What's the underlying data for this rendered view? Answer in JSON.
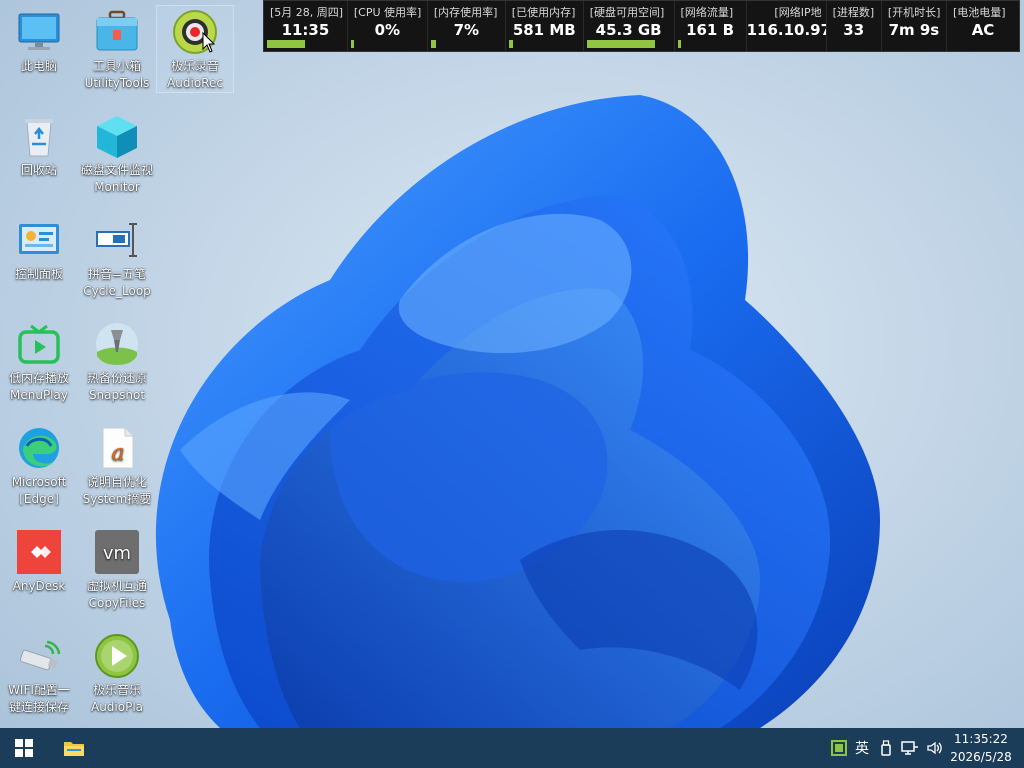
{
  "desktop": {
    "icons": [
      {
        "label": "此电脑",
        "icon": "this-pc-icon"
      },
      {
        "label": "工具小箱",
        "label2": "UtilityTools",
        "icon": "toolbox-icon"
      },
      {
        "label": "极乐录音",
        "label2": "AudioRec",
        "icon": "audio-recorder-icon"
      },
      {
        "label": "回收站",
        "icon": "recycle-bin-icon"
      },
      {
        "label": "磁盘文件监视",
        "label2": "Monitor",
        "icon": "disk-monitor-icon"
      },
      {
        "label": "控制面板",
        "icon": "control-panel-icon"
      },
      {
        "label": "拼音=五笔",
        "label2": "Cycle_Loop",
        "icon": "input-method-icon"
      },
      {
        "label": "低内存播放",
        "label2": "MenuPlay",
        "icon": "tv-player-icon"
      },
      {
        "label": "热备份还原",
        "label2": "Snapshot",
        "icon": "snapshot-icon"
      },
      {
        "label": "Microsoft",
        "label2": "[Edge]",
        "icon": "edge-browser-icon"
      },
      {
        "label": "说明自优化",
        "label2": "System摘要",
        "icon": "document-icon"
      },
      {
        "label": "AnyDesk",
        "icon": "anydesk-icon"
      },
      {
        "label": "虚拟机互通",
        "label2": "CopyFiles",
        "icon": "vmware-icon"
      },
      {
        "label": "WIFI配置一",
        "label2": "键连接保存",
        "icon": "wifi-adapter-icon"
      },
      {
        "label": "极乐音乐",
        "label2": "AudioPla",
        "icon": "music-player-icon"
      }
    ]
  },
  "monitor": {
    "cells": [
      {
        "label": "[5月 28, 周四]",
        "value": "11:35",
        "bar": 0.5
      },
      {
        "label": "[CPU 使用率]",
        "value": "0%",
        "bar": 0.02
      },
      {
        "label": "[内存使用率]",
        "value": "7%",
        "bar": 0.07
      },
      {
        "label": "[已使用内存]",
        "value": "581 MB",
        "bar": 0.05
      },
      {
        "label": "[硬盘可用空间]",
        "value": "45.3 GB",
        "bar": 0.82
      },
      {
        "label": "[网络流量]",
        "value": "161 B",
        "bar": 0.02
      },
      {
        "label": "[网络IP地",
        "value": "116.10.97",
        "bar": 0
      },
      {
        "label": "[进程数]",
        "value": "33",
        "bar": 0
      },
      {
        "label": "[开机时长]",
        "value": "7m 9s",
        "bar": 0
      },
      {
        "label": "[电池电量]",
        "value": "AC",
        "bar": 0
      }
    ]
  },
  "taskbar": {
    "start_icon": "windows-start-icon",
    "pinned_icon": "file-explorer-icon",
    "tray": {
      "language": "英",
      "clock_time": "11:35:22",
      "clock_date": "2026/5/28"
    }
  },
  "colors": {
    "taskbar": "#1b3d5a",
    "monitor_bar": "#8fc540",
    "monitor_bg": "#141414"
  }
}
